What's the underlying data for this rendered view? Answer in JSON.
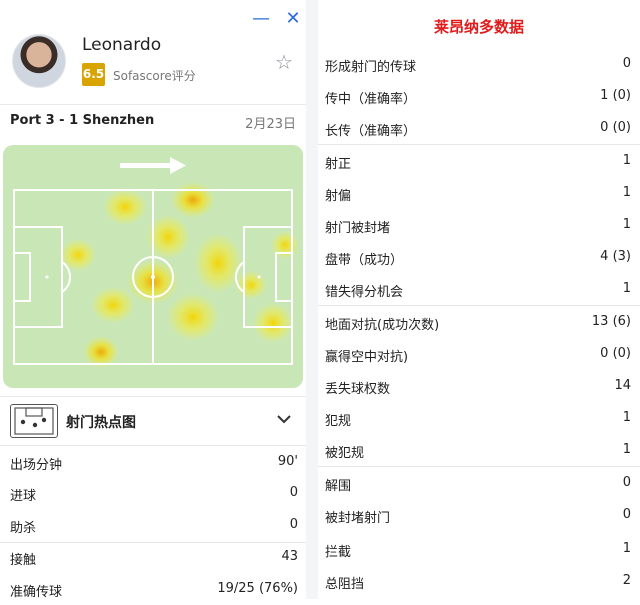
{
  "window": {
    "minimize_glyph": "—",
    "close_glyph": "✕"
  },
  "player": {
    "name": "Leonardo",
    "rating": "6.5",
    "rating_source": "Sofascore评分",
    "star_glyph": "☆"
  },
  "match": {
    "teams_score": "Port 3 - 1 Shenzhen",
    "date": "2月23日"
  },
  "heatmap": {
    "section_title": "射门热点图",
    "chevron_glyph": "⌄"
  },
  "left_stats": [
    {
      "label": "出场分钟",
      "value": "90'"
    },
    {
      "label": "进球",
      "value": "0"
    },
    {
      "label": "助杀",
      "value": "0"
    },
    {
      "label": "接触",
      "value": "43"
    },
    {
      "label": "准确传球",
      "value": "19/25 (76%)"
    }
  ],
  "right_panel": {
    "title": "莱昂纳多数据",
    "stats": [
      {
        "label": "形成射门的传球",
        "value": "0"
      },
      {
        "label": "传中（准确率）",
        "value": "1 (0)"
      },
      {
        "label": "长传（准确率）",
        "value": "0 (0)"
      },
      {
        "label": "射正",
        "value": "1"
      },
      {
        "label": "射偏",
        "value": "1"
      },
      {
        "label": "射门被封堵",
        "value": "1"
      },
      {
        "label": "盘带（成功）",
        "value": "4 (3)"
      },
      {
        "label": "错失得分机会",
        "value": "1"
      },
      {
        "label": "地面对抗(成功次数)",
        "value": "13 (6)"
      },
      {
        "label": "赢得空中对抗)",
        "value": "0 (0)"
      },
      {
        "label": "丢失球权数",
        "value": "14"
      },
      {
        "label": "犯规",
        "value": "1"
      },
      {
        "label": "被犯规",
        "value": "1"
      },
      {
        "label": "解围",
        "value": "0"
      },
      {
        "label": "被封堵射门",
        "value": "0"
      },
      {
        "label": "拦截",
        "value": "1"
      },
      {
        "label": "总阻挡",
        "value": "2"
      }
    ]
  },
  "colors": {
    "accent": "#2c6cd6",
    "rating_bg": "#d9a400",
    "title_red": "#e01b1b",
    "pitch": "#c9e7b6",
    "heat": "#f2e600"
  }
}
